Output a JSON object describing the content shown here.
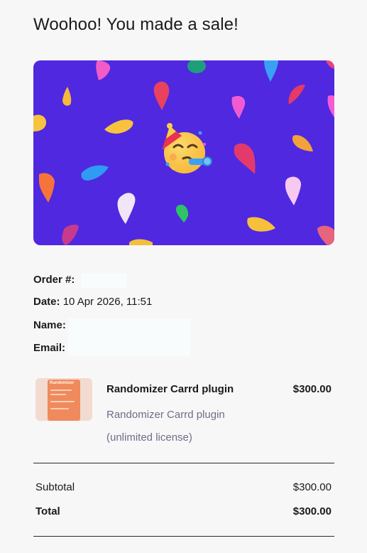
{
  "headline": "Woohoo! You made a sale!",
  "banner": {
    "icon": "party-face-emoji",
    "background_color": "#4f28e0"
  },
  "order": {
    "order_label": "Order #:",
    "date_label": "Date:",
    "date_value": "10 Apr 2026, 11:51",
    "name_label": "Name:",
    "email_label": "Email:"
  },
  "product": {
    "thumb_title": "Randomizer",
    "name": "Randomizer Carrd plugin",
    "description": "Randomizer Carrd plugin (unlimited license)",
    "price": "$300.00"
  },
  "summary": {
    "subtotal_label": "Subtotal",
    "subtotal_value": "$300.00",
    "total_label": "Total",
    "total_value": "$300.00"
  }
}
